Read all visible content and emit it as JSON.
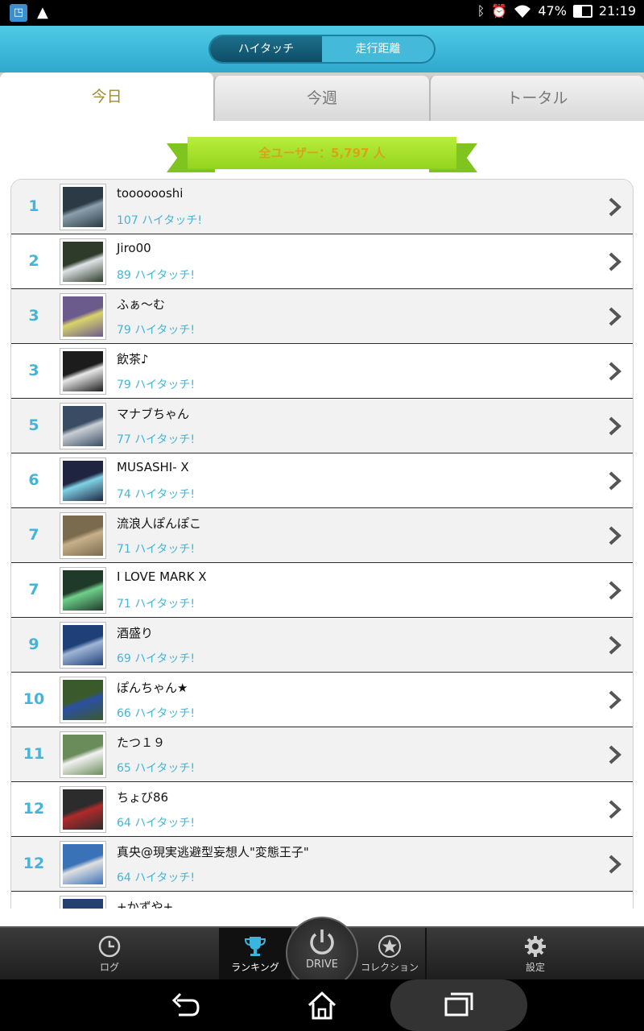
{
  "status_bar": {
    "battery": "47%",
    "time": "21:19",
    "icons": [
      "bluetooth-icon",
      "alarm-icon",
      "wifi-icon",
      "battery-charging-icon"
    ]
  },
  "header": {
    "segments": [
      {
        "label": "ハイタッチ",
        "active": true
      },
      {
        "label": "走行距離",
        "active": false
      }
    ]
  },
  "tabs": [
    {
      "label": "今日",
      "active": true
    },
    {
      "label": "今週",
      "active": false
    },
    {
      "label": "トータル",
      "active": false
    }
  ],
  "ribbon": {
    "text": "全ユーザー：5,797 人"
  },
  "ranking": [
    {
      "rank": "1",
      "name": "tooooooshi",
      "score": "107 ハイタッチ!"
    },
    {
      "rank": "2",
      "name": "Jiro00",
      "score": "89 ハイタッチ!"
    },
    {
      "rank": "3",
      "name": "ふぁ〜む",
      "score": "79 ハイタッチ!"
    },
    {
      "rank": "3",
      "name": "飲茶♪",
      "score": "79 ハイタッチ!"
    },
    {
      "rank": "5",
      "name": "マナブちゃん",
      "score": "77 ハイタッチ!"
    },
    {
      "rank": "6",
      "name": "MUSASHI- X",
      "score": "74 ハイタッチ!"
    },
    {
      "rank": "7",
      "name": "流浪人ぽんぽこ",
      "score": "71 ハイタッチ!"
    },
    {
      "rank": "7",
      "name": "I LOVE MARK X",
      "score": "71 ハイタッチ!"
    },
    {
      "rank": "9",
      "name": "酒盛り",
      "score": "69 ハイタッチ!"
    },
    {
      "rank": "10",
      "name": "ぽんちゃん★",
      "score": "66 ハイタッチ!"
    },
    {
      "rank": "11",
      "name": "たつ１９",
      "score": "65 ハイタッチ!"
    },
    {
      "rank": "12",
      "name": "ちょび86",
      "score": "64 ハイタッチ!"
    },
    {
      "rank": "12",
      "name": "真央@現実逃避型妄想人\"変態王子\"",
      "score": "64 ハイタッチ!"
    },
    {
      "rank": "",
      "name": "+かずや+",
      "score": ""
    }
  ],
  "bottom_nav": {
    "log": "ログ",
    "ranking": "ランキング",
    "drive": "DRIVE",
    "collection": "コレクション",
    "settings": "設定"
  }
}
